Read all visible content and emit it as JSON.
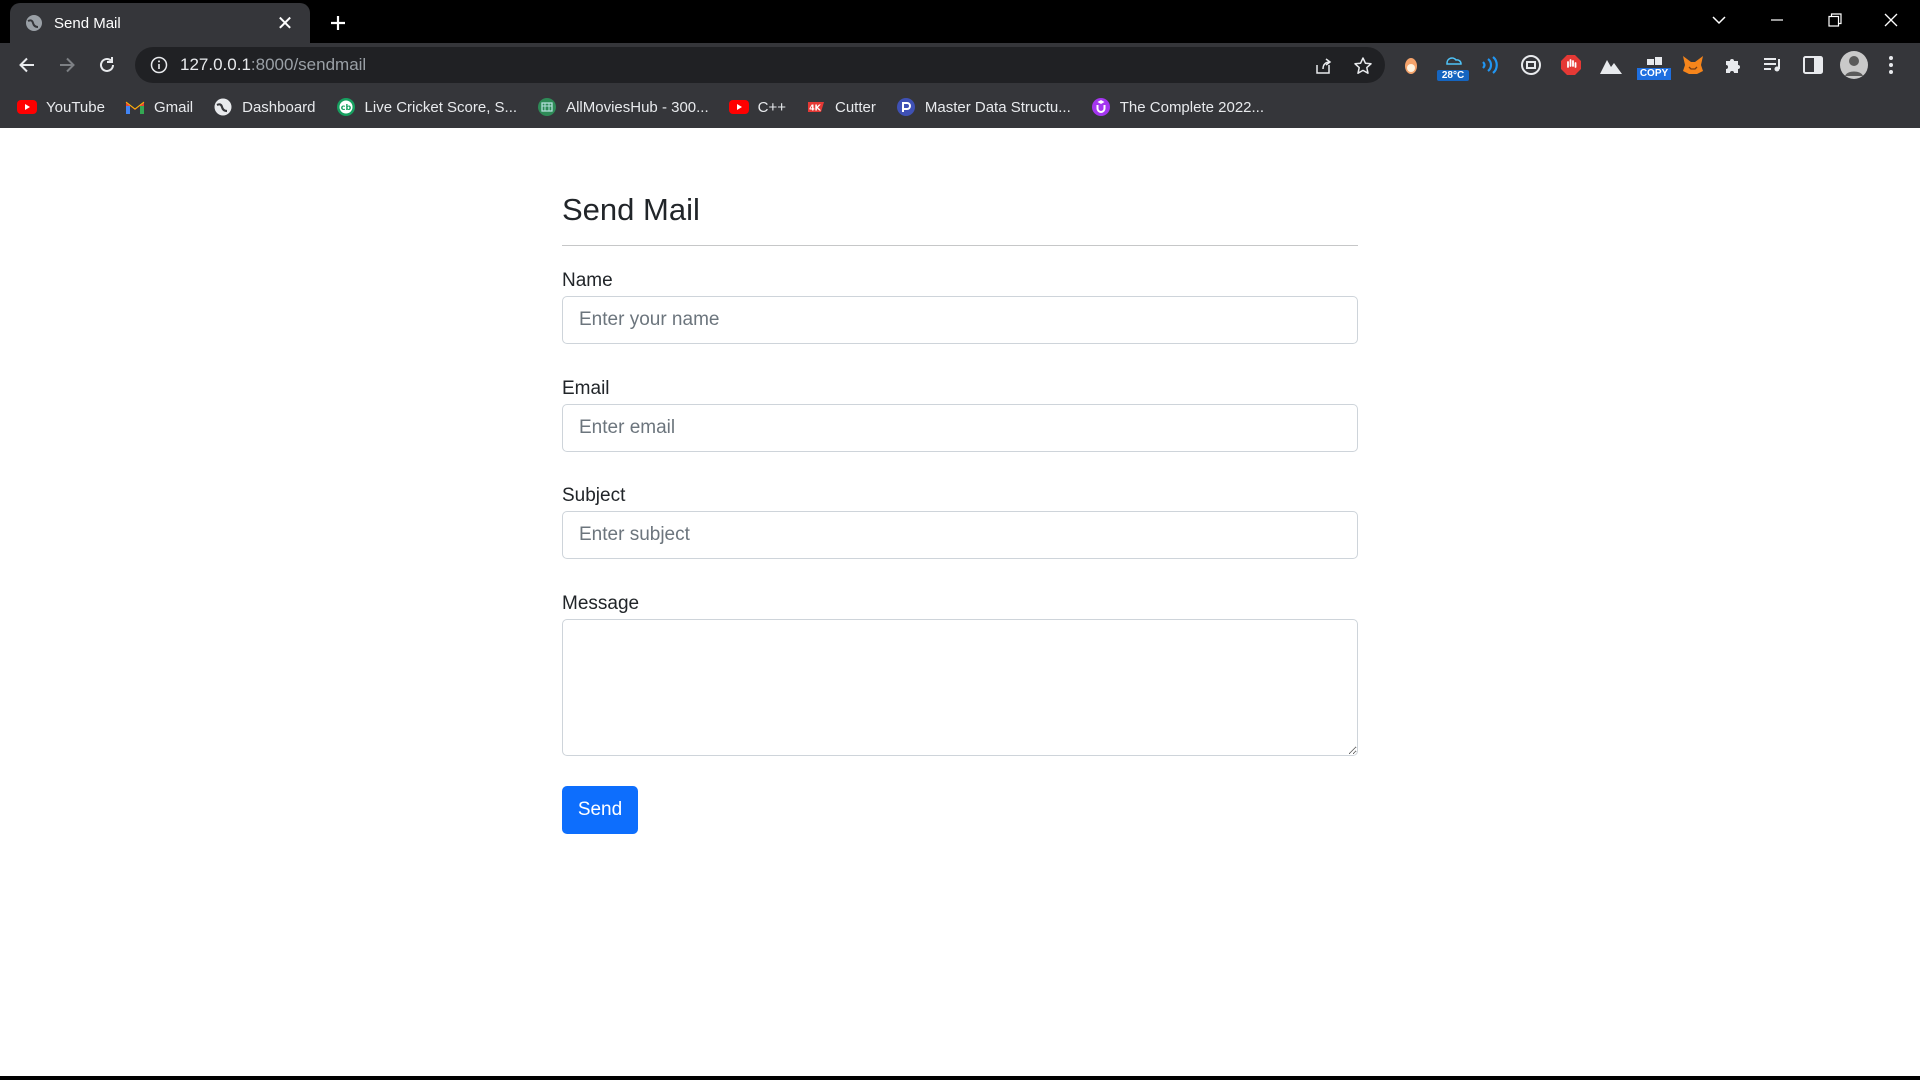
{
  "browser": {
    "tab": {
      "title": "Send Mail",
      "close_glyph": "✕"
    },
    "newtab_glyph": "+",
    "url": {
      "host": "127.0.0.1",
      "rest": ":8000/sendmail"
    },
    "weather_ext": {
      "temp": "28°C"
    },
    "copy_ext": {
      "label": "COPY"
    },
    "bookmarks": [
      {
        "label": "YouTube",
        "icon": "youtube-icon",
        "color": "#ff0000"
      },
      {
        "label": "Gmail",
        "icon": "gmail-icon",
        "color": "#ea4335"
      },
      {
        "label": "Dashboard",
        "icon": "globe-icon",
        "color": "#e8eaed"
      },
      {
        "label": "Live Cricket Score, S...",
        "icon": "cricbuzz-icon",
        "color": "#17a060"
      },
      {
        "label": "AllMoviesHub - 300...",
        "icon": "allmovieshub-icon",
        "color": "#2e8b57"
      },
      {
        "label": "C++",
        "icon": "youtube-icon",
        "color": "#ff0000"
      },
      {
        "label": "Cutter",
        "icon": "4k-icon",
        "color": "#e53935"
      },
      {
        "label": "Master Data Structu...",
        "icon": "course-icon",
        "color": "#3f51b5"
      },
      {
        "label": "The Complete 2022...",
        "icon": "udemy-icon",
        "color": "#a435f0"
      }
    ]
  },
  "form": {
    "title": "Send Mail",
    "name": {
      "label": "Name",
      "placeholder": "Enter your name",
      "value": ""
    },
    "email": {
      "label": "Email",
      "placeholder": "Enter email",
      "value": ""
    },
    "subject": {
      "label": "Subject",
      "placeholder": "Enter subject",
      "value": ""
    },
    "message": {
      "label": "Message",
      "value": ""
    },
    "send_label": "Send"
  },
  "colors": {
    "primary": "#0d6efd",
    "browser_bg": "#35363a",
    "omnibox_bg": "#202124"
  }
}
